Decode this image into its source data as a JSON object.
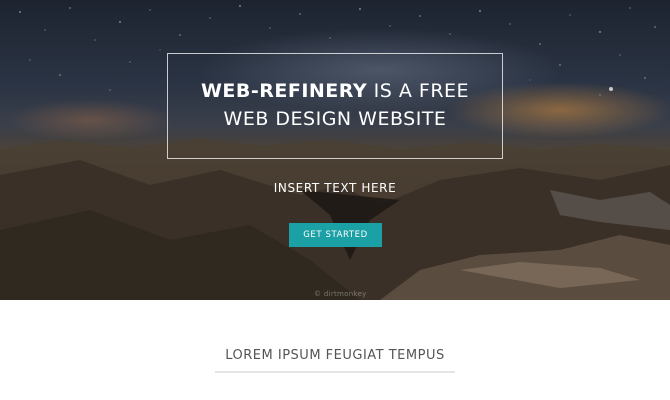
{
  "hero": {
    "title_strong": "WEB-REFINERY",
    "title_rest": " IS A FREE",
    "title_line2": "WEB DESIGN WEBSITE",
    "subtitle": "INSERT TEXT HERE",
    "cta_label": "GET STARTED",
    "watermark": "© dirtmonkey",
    "accent_color": "#1aa0a5"
  },
  "section": {
    "heading": "LOREM IPSUM FEUGIAT TEMPUS"
  }
}
